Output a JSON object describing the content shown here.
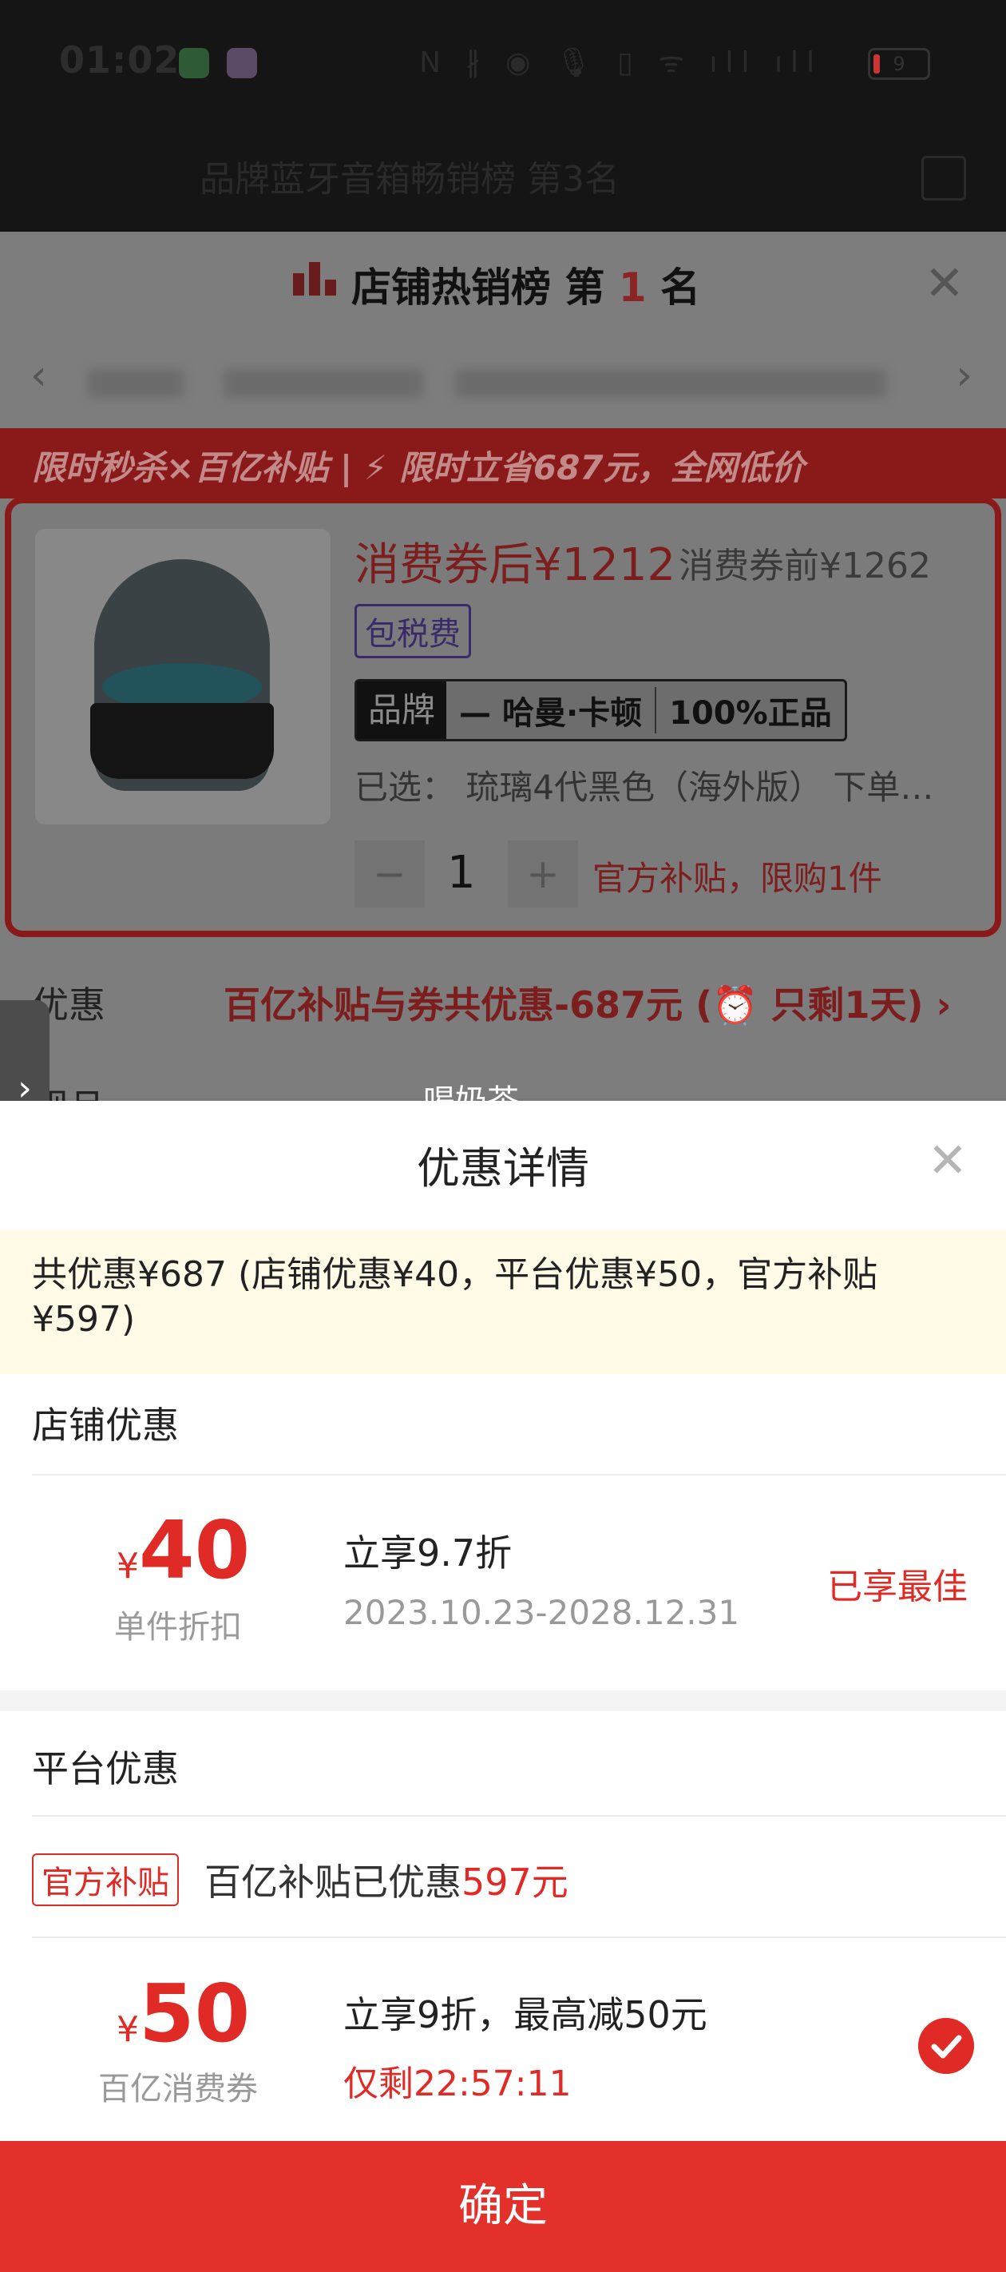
{
  "status_bar": {
    "time": "01:02",
    "battery": "9",
    "icons": "N ∦ ◉  🎙 ▯ ᯤ ıll ıll"
  },
  "background_sheet": {
    "ghost_rank_text": "品牌蓝牙音箱畅销榜 第3名",
    "rank_title_prefix": "店铺热销榜 第",
    "rank_number": "1",
    "rank_title_suffix": "名",
    "promo_banner": "限时秒杀×百亿补贴 | ⚡ 限时立省687元，全网低价",
    "price_after": "消费券后¥1212",
    "price_before": "消费券前¥1262",
    "tax_badge": "包税费",
    "brand_label": "品牌",
    "brand_name": "— 哈曼·卡顿",
    "brand_guarantee": "100%正品",
    "selected": "已选：  琉璃4代黑色（海外版） 下单…",
    "quantity": "1",
    "limit_text": "官方补贴，限购1件",
    "discount_label": "优惠",
    "discount_summary": "百亿补贴与券共优惠-687元 (⏰ 只剩1天) ›",
    "cut_label": "规且",
    "milk_tea": "喝奶茶"
  },
  "popup": {
    "title": "优惠详情",
    "summary": "共优惠¥687 (店铺优惠¥40，平台优惠¥50，官方补贴¥597)",
    "shop_section": {
      "heading": "店铺优惠",
      "amount": "40",
      "caption": "单件折扣",
      "description": "立享9.7折",
      "dates": "2023.10.23-2028.12.31",
      "status": "已享最佳"
    },
    "platform_section": {
      "heading": "平台优惠",
      "tag": "官方补贴",
      "subsidy_prefix": "百亿补贴已优惠",
      "subsidy_amount": "597元",
      "amount": "50",
      "caption": "百亿消费券",
      "description": "立享9折，最高减50元",
      "timer": "仅剩22:57:11"
    },
    "yen": "¥",
    "confirm": "确定"
  },
  "colors": {
    "accent": "#e02a26",
    "summary_bg": "#fffbe7",
    "confirm_bg": "#e3302b"
  }
}
